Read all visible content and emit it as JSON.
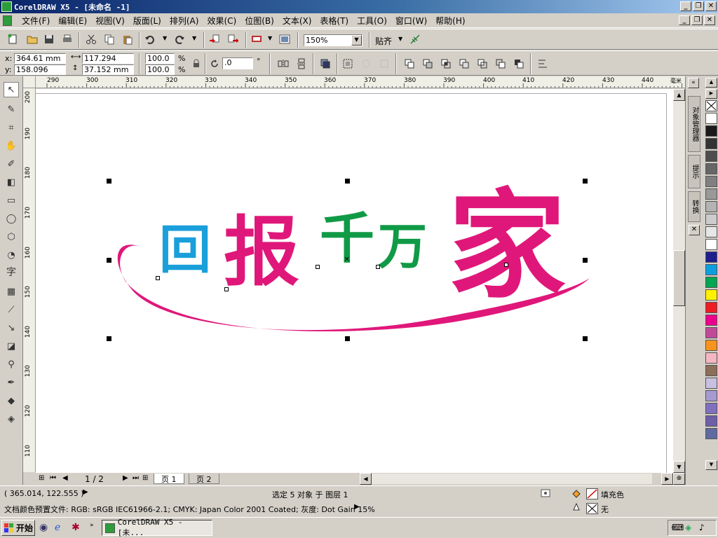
{
  "window": {
    "title": "CorelDRAW X5 - [未命名 -1]",
    "min": "_",
    "max": "❐",
    "close": "✕"
  },
  "menu": [
    "文件(F)",
    "编辑(E)",
    "视图(V)",
    "版面(L)",
    "排列(A)",
    "效果(C)",
    "位图(B)",
    "文本(X)",
    "表格(T)",
    "工具(O)",
    "窗口(W)",
    "帮助(H)"
  ],
  "toolbar": {
    "zoom": "150%",
    "snap": "贴齐"
  },
  "property": {
    "x_label": "x:",
    "x": "364.61 mm",
    "y_label": "y:",
    "y": "158.096 mm",
    "w": "117.294 mm",
    "h": "37.152 mm",
    "sx": "100.0",
    "sy": "100.0",
    "pct": "%",
    "angle": ".0",
    "deg": "°"
  },
  "ruler": {
    "top": [
      "290",
      "300",
      "310",
      "320",
      "330",
      "340",
      "350",
      "360",
      "370",
      "380",
      "390",
      "400",
      "410",
      "420",
      "430",
      "440"
    ],
    "unit": "毫米",
    "left": [
      "200",
      "190",
      "180",
      "170",
      "160",
      "150",
      "140",
      "130",
      "120",
      "110"
    ]
  },
  "artwork": {
    "c1": "回",
    "c2": "报",
    "c3": "千",
    "c4": "万",
    "c5": "家",
    "blue": "#1a9fdb",
    "pink": "#e0177a",
    "green": "#109a46"
  },
  "pages": {
    "count": "1 / 2",
    "tab1": "页 1",
    "tab2": "页 2"
  },
  "docker": {
    "tab1": "对象管理器",
    "tab2": "提示",
    "tab3": "转换"
  },
  "status": {
    "coords": "( 365.014, 122.555 )",
    "selection": "选定 5 对象 于 图层 1",
    "profile": "文档颜色预置文件: RGB: sRGB IEC61966-2.1; CMYK: Japan Color 2001 Coated; 灰度: Dot Gain 15%",
    "fill": "填充色",
    "outline": "无"
  },
  "taskbar": {
    "start": "开始",
    "task": "CorelDRAW X5 - [未..."
  },
  "palette": [
    "#ffffff",
    "#1a1a1a",
    "#333333",
    "#4d4d4d",
    "#666666",
    "#808080",
    "#999999",
    "#b3b3b3",
    "#cccccc",
    "#e6e6e6",
    "#ffffff",
    "#1e1e8c",
    "#0b9fe0",
    "#00a651",
    "#fff200",
    "#ed1c24",
    "#ec008c",
    "#c2489a",
    "#f7941d",
    "#f4b6c0",
    "#8c6e5a",
    "#c8c0e0",
    "#a59ad0",
    "#8070c0",
    "#6e5fa8",
    "#5e6aa0"
  ]
}
